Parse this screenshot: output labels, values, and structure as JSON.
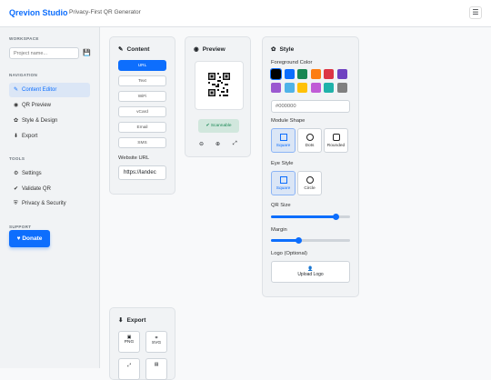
{
  "header": {
    "brand": "Qrevion Studio",
    "tagline": "Privacy-First QR Generator",
    "menu_icon": "☰"
  },
  "sidebar": {
    "workspace_label": "WORKSPACE",
    "project_placeholder": "Project name...",
    "navigation_label": "NAVIGATION",
    "nav": [
      {
        "label": "Content Editor",
        "icon": "✎"
      },
      {
        "label": "QR Preview",
        "icon": "◉"
      },
      {
        "label": "Style & Design",
        "icon": "✿"
      },
      {
        "label": "Export",
        "icon": "⬇"
      }
    ],
    "tools_label": "TOOLS",
    "tools": [
      {
        "label": "Settings",
        "icon": "⚙"
      },
      {
        "label": "Validate QR",
        "icon": "✔"
      },
      {
        "label": "Privacy & Security",
        "icon": "⛨"
      }
    ],
    "support_label": "SUPPORT",
    "donate_label": "Donate"
  },
  "content": {
    "title": "Content",
    "types": [
      "URL",
      "Text",
      "WiFi",
      "vCard",
      "Email",
      "SMS"
    ],
    "selected": "URL",
    "url_label": "Website URL",
    "url_value": "https://landec"
  },
  "preview": {
    "title": "Preview",
    "status": "Scannable",
    "tools": [
      "⊖",
      "⊕",
      "⤢"
    ]
  },
  "style": {
    "title": "Style",
    "fg_label": "Foreground Color",
    "colors": [
      "#000000",
      "#0d6efd",
      "#198754",
      "#fd7e14",
      "#dc3545",
      "#6f42c1",
      "#9b59d0",
      "#4fb3e8",
      "#ffc107",
      "#c05cd6",
      "#20b2aa",
      "#808080"
    ],
    "hex_value": "#000000",
    "module_label": "Module Shape",
    "modules": [
      "Square",
      "Dots",
      "Rounded"
    ],
    "eye_label": "Eye Style",
    "eyes": [
      "Square",
      "Circle"
    ],
    "size_label": "QR Size",
    "size_value": 0.82,
    "margin_label": "Margin",
    "margin_value": 0.35,
    "logo_label": "Logo (Optional)",
    "upload_label": "Upload Logo"
  },
  "export": {
    "title": "Export",
    "formats": [
      "PNG",
      "SVG"
    ]
  }
}
